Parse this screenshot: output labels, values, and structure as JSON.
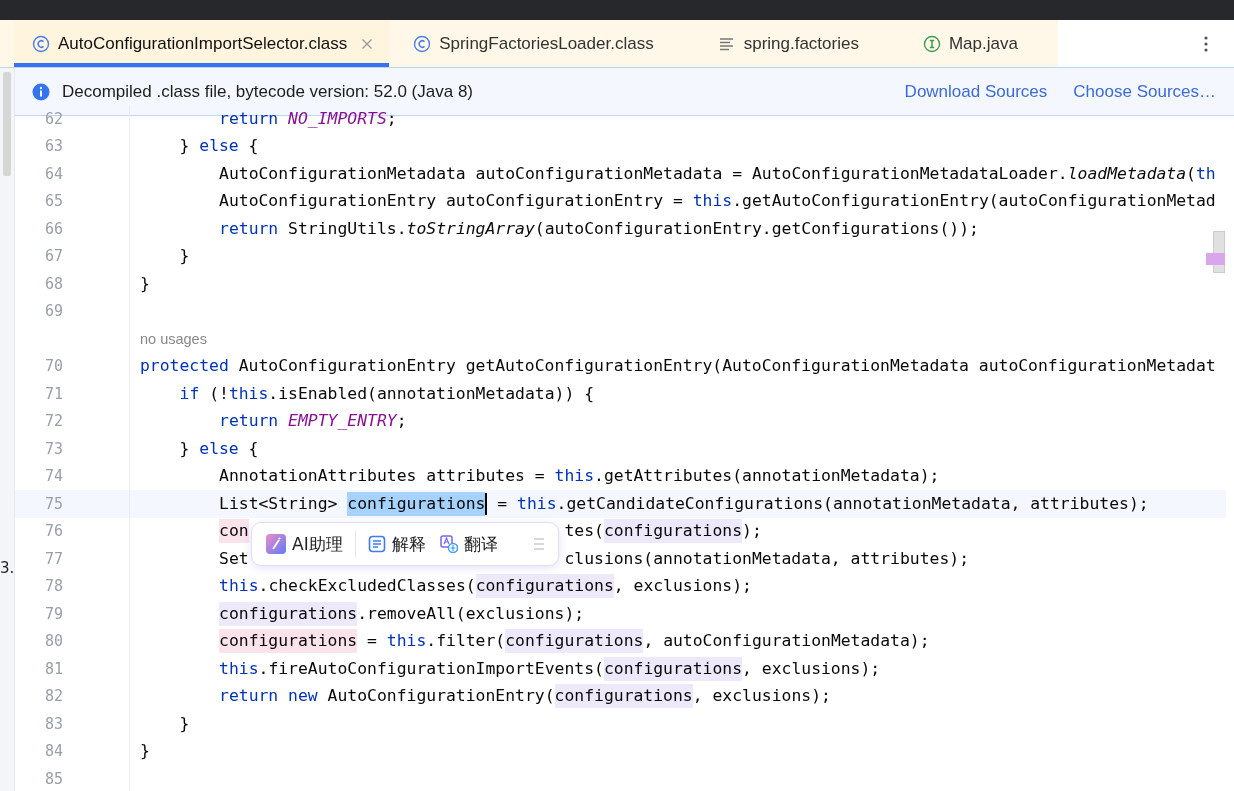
{
  "tabs": [
    {
      "label": "AutoConfigurationImportSelector.class",
      "kind": "class",
      "selected": true
    },
    {
      "label": "SpringFactoriesLoader.class",
      "kind": "class",
      "selected": false
    },
    {
      "label": "spring.factories",
      "kind": "text",
      "selected": false
    },
    {
      "label": "Map.java",
      "kind": "interface",
      "selected": false
    }
  ],
  "info_bar": {
    "message": "Decompiled .class file, bytecode version: 52.0 (Java 8)",
    "links": [
      "Download Sources",
      "Choose Sources…"
    ]
  },
  "edge_text": "3.",
  "code_lines": [
    {
      "kind": "block",
      "children": [
        {
          "kind": "block",
          "children": [
            {
              "kind": "code",
              "num": "62",
              "segments": [
                [
                  {
                    "text": "return ",
                    "kind": "keyword"
                  },
                  {
                    "text": "NO_IMPORTS",
                    "kind": "constant"
                  },
                  {
                    "text": ";",
                    "kind": "plain"
                  }
                ]
              ]
            }
          ]
        },
        {
          "kind": "code",
          "num": "63",
          "segments": [
            [
              {
                "text": "} ",
                "kind": "plain"
              },
              {
                "text": "else",
                "kind": "keyword"
              },
              {
                "text": " {",
                "kind": "plain"
              }
            ]
          ],
          "children": [
            {
              "kind": "code",
              "num": "64",
              "segments": [
                [
                  {
                    "text": "AutoConfigurationMetadata autoConfigurationMetadata = AutoConfigurationMetadataLoader.",
                    "kind": "plain"
                  },
                  {
                    "text": "loadMetadata",
                    "kind": "italic"
                  },
                  {
                    "text": "(",
                    "kind": "plain"
                  },
                  {
                    "text": "th",
                    "kind": "keyword"
                  }
                ]
              ]
            },
            {
              "kind": "code",
              "num": "65",
              "segments": [
                [
                  {
                    "text": "AutoConfigurationEntry autoConfigurationEntry = ",
                    "kind": "plain"
                  },
                  {
                    "text": "this",
                    "kind": "keyword"
                  },
                  {
                    "text": ".getAutoConfigurationEntry(autoConfigurationMetad",
                    "kind": "plain"
                  }
                ]
              ]
            },
            {
              "kind": "code",
              "num": "66",
              "segments": [
                [
                  {
                    "text": "return",
                    "kind": "keyword"
                  },
                  {
                    "text": " StringUtils.",
                    "kind": "plain"
                  },
                  {
                    "text": "toStringArray",
                    "kind": "italic"
                  },
                  {
                    "text": "(autoConfigurationEntry.getConfigurations());",
                    "kind": "plain"
                  }
                ]
              ]
            }
          ]
        },
        {
          "kind": "code",
          "num": "67",
          "segments": [
            [
              {
                "text": "}",
                "kind": "plain"
              }
            ]
          ]
        }
      ]
    },
    {
      "kind": "code",
      "num": "68",
      "segments": [
        [
          {
            "text": "}",
            "kind": "plain"
          }
        ]
      ]
    },
    {
      "kind": "code",
      "num": "69"
    },
    {
      "kind": "hint",
      "text": "no usages"
    },
    {
      "kind": "code",
      "num": "70",
      "segments": [
        [
          {
            "text": "protected",
            "kind": "keyword"
          },
          {
            "text": " AutoConfigurationEntry getAutoConfigurationEntry(AutoConfigurationMetadata autoConfigurationMetadat",
            "kind": "plain"
          }
        ]
      ],
      "children": [
        {
          "kind": "code",
          "num": "71",
          "segments": [
            [
              {
                "text": "if",
                "kind": "keyword"
              },
              {
                "text": " (!",
                "kind": "plain"
              },
              {
                "text": "this",
                "kind": "keyword"
              },
              {
                "text": ".isEnabled(annotationMetadata)) {",
                "kind": "plain"
              }
            ]
          ],
          "children": [
            {
              "kind": "code",
              "num": "72",
              "segments": [
                [
                  {
                    "text": "return ",
                    "kind": "keyword"
                  },
                  {
                    "text": "EMPTY_ENTRY",
                    "kind": "constant"
                  },
                  {
                    "text": ";",
                    "kind": "plain"
                  }
                ]
              ]
            }
          ]
        },
        {
          "kind": "code",
          "num": "73",
          "segments": [
            [
              {
                "text": "} ",
                "kind": "plain"
              },
              {
                "text": "else",
                "kind": "keyword"
              },
              {
                "text": " {",
                "kind": "plain"
              }
            ]
          ],
          "children": [
            {
              "kind": "code",
              "num": "74",
              "segments": [
                [
                  {
                    "text": "AnnotationAttributes attributes = ",
                    "kind": "plain"
                  },
                  {
                    "text": "this",
                    "kind": "keyword"
                  },
                  {
                    "text": ".getAttributes(annotationMetadata);",
                    "kind": "plain"
                  }
                ]
              ]
            },
            {
              "kind": "code",
              "num": "75",
              "current": true,
              "segments": [
                [
                  {
                    "text": "List<String> ",
                    "kind": "plain"
                  },
                  {
                    "text": "configurations",
                    "kind": "selected"
                  },
                  {
                    "text": " = ",
                    "kind": "plain"
                  },
                  {
                    "text": "this",
                    "kind": "keyword"
                  },
                  {
                    "text": ".getCandidateConfigurations(annotationMetadata, attributes);",
                    "kind": "plain"
                  }
                ]
              ]
            },
            {
              "kind": "code",
              "num": "76",
              "segments": [
                [
                  {
                    "text": "con",
                    "kind": "write"
                  }
                ],
                [
                  {
                    "text": "tes(",
                    "kind": "plain"
                  },
                  {
                    "text": "configurations",
                    "kind": "usage"
                  },
                  {
                    "text": ");",
                    "kind": "plain"
                  }
                ]
              ]
            },
            {
              "kind": "code",
              "num": "77",
              "segments": [
                [
                  {
                    "text": "Set",
                    "kind": "plain"
                  }
                ],
                [
                  {
                    "text": "clusions(annotationMetadata, attributes);",
                    "kind": "plain"
                  }
                ]
              ]
            },
            {
              "kind": "code",
              "num": "78",
              "segments": [
                [
                  {
                    "text": "this",
                    "kind": "keyword"
                  },
                  {
                    "text": ".checkExcludedClasses(",
                    "kind": "plain"
                  },
                  {
                    "text": "configurations",
                    "kind": "usage"
                  },
                  {
                    "text": ", exclusions);",
                    "kind": "plain"
                  }
                ]
              ]
            },
            {
              "kind": "code",
              "num": "79",
              "segments": [
                [
                  {
                    "text": "configurations",
                    "kind": "usage"
                  },
                  {
                    "text": ".removeAll(exclusions);",
                    "kind": "plain"
                  }
                ]
              ]
            },
            {
              "kind": "code",
              "num": "80",
              "segments": [
                [
                  {
                    "text": "configurations",
                    "kind": "write"
                  },
                  {
                    "text": " = ",
                    "kind": "plain"
                  },
                  {
                    "text": "this",
                    "kind": "keyword"
                  },
                  {
                    "text": ".filter(",
                    "kind": "plain"
                  },
                  {
                    "text": "configurations",
                    "kind": "usage"
                  },
                  {
                    "text": ", autoConfigurationMetadata);",
                    "kind": "plain"
                  }
                ]
              ]
            },
            {
              "kind": "code",
              "num": "81",
              "segments": [
                [
                  {
                    "text": "this",
                    "kind": "keyword"
                  },
                  {
                    "text": ".fireAutoConfigurationImportEvents(",
                    "kind": "plain"
                  },
                  {
                    "text": "configurations",
                    "kind": "usage"
                  },
                  {
                    "text": ", exclusions);",
                    "kind": "plain"
                  }
                ]
              ]
            },
            {
              "kind": "code",
              "num": "82",
              "segments": [
                [
                  {
                    "text": "return new",
                    "kind": "keyword"
                  },
                  {
                    "text": " AutoConfigurationEntry(",
                    "kind": "plain"
                  },
                  {
                    "text": "configurations",
                    "kind": "usage"
                  },
                  {
                    "text": ", exclusions);",
                    "kind": "plain"
                  }
                ]
              ]
            }
          ]
        },
        {
          "kind": "code",
          "num": "83",
          "segments": [
            [
              {
                "text": "}",
                "kind": "plain"
              }
            ]
          ]
        }
      ]
    },
    {
      "kind": "code",
      "num": "84",
      "segments": [
        [
          {
            "text": "}",
            "kind": "plain"
          }
        ]
      ]
    },
    {
      "kind": "code",
      "num": "85"
    }
  ],
  "popup": {
    "items": [
      {
        "label": "AI助理",
        "kind": "ai"
      },
      {
        "label": "解释",
        "kind": "explain"
      },
      {
        "label": "翻译",
        "kind": "translate"
      }
    ]
  }
}
